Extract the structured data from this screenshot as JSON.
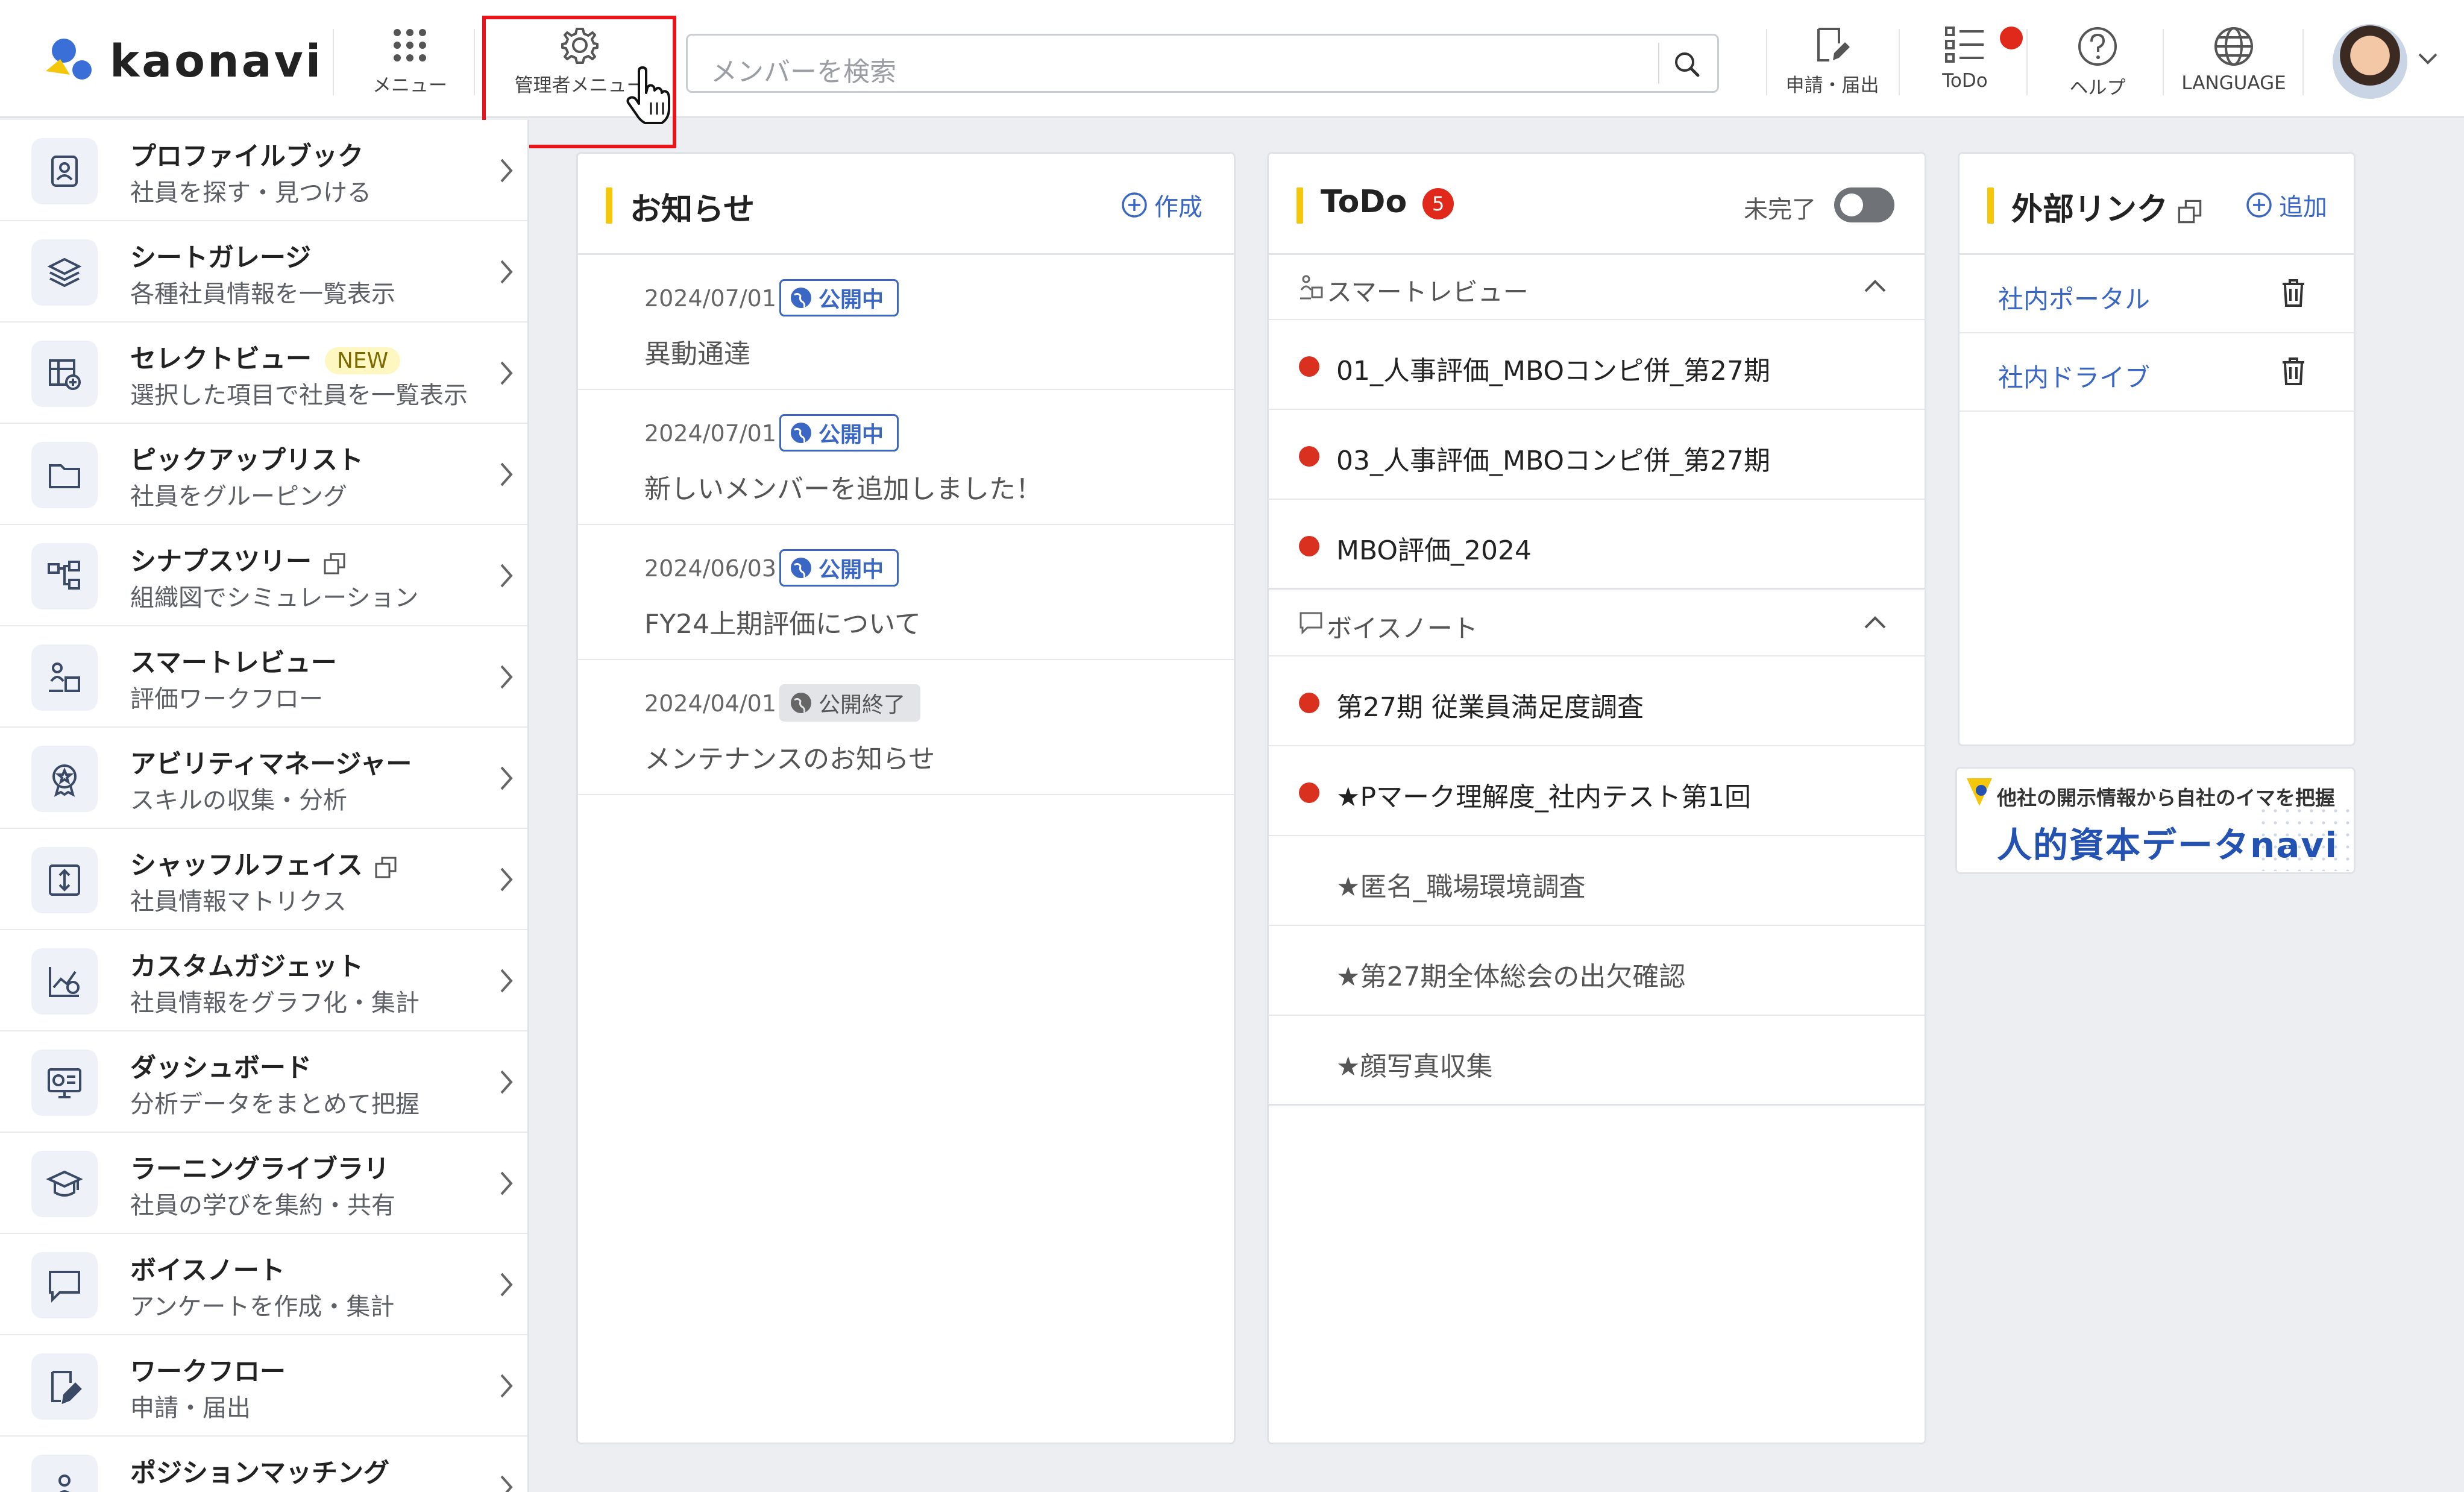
{
  "header": {
    "logo_text": "kaonavi",
    "menu_label": "メニュー",
    "admin_menu_label": "管理者メニュー",
    "search_placeholder": "メンバーを検索",
    "apply_label": "申請・届出",
    "todo_label": "ToDo",
    "help_label": "ヘルプ",
    "language_label": "LANGUAGE"
  },
  "sidebar": {
    "items": [
      {
        "title": "プロファイルブック",
        "subtitle": "社員を探す・見つける",
        "icon": "profile-book-icon"
      },
      {
        "title": "シートガレージ",
        "subtitle": "各種社員情報を一覧表示",
        "icon": "layers-icon"
      },
      {
        "title": "セレクトビュー",
        "badge": "NEW",
        "subtitle": "選択した項目で社員を一覧表示",
        "icon": "select-view-icon"
      },
      {
        "title": "ピックアップリスト",
        "subtitle": "社員をグルーピング",
        "icon": "folder-icon"
      },
      {
        "title": "シナプスツリー",
        "subtitle": "組織図でシミュレーション",
        "icon": "org-tree-icon"
      },
      {
        "title": "スマートレビュー",
        "subtitle": "評価ワークフロー",
        "icon": "review-icon"
      },
      {
        "title": "アビリティマネージャー",
        "subtitle": "スキルの収集・分析",
        "icon": "award-icon"
      },
      {
        "title": "シャッフルフェイス",
        "subtitle": "社員情報マトリクス",
        "icon": "shuffle-icon"
      },
      {
        "title": "カスタムガジェット",
        "subtitle": "社員情報をグラフ化・集計",
        "icon": "chart-icon"
      },
      {
        "title": "ダッシュボード",
        "subtitle": "分析データをまとめて把握",
        "icon": "dashboard-icon"
      },
      {
        "title": "ラーニングライブラリ",
        "subtitle": "社員の学びを集約・共有",
        "icon": "graduation-cap-icon"
      },
      {
        "title": "ボイスノート",
        "subtitle": "アンケートを作成・集計",
        "icon": "speech-bubble-icon"
      },
      {
        "title": "ワークフロー",
        "subtitle": "申請・届出",
        "icon": "workflow-icon"
      },
      {
        "title": "ポジションマッチング",
        "subtitle": "",
        "icon": "position-icon"
      }
    ]
  },
  "news": {
    "title": "お知らせ",
    "create_label": "作成",
    "items": [
      {
        "date": "2024/07/01",
        "status": "公開中",
        "body": "異動通達"
      },
      {
        "date": "2024/07/01",
        "status": "公開中",
        "body": "新しいメンバーを追加しました！"
      },
      {
        "date": "2024/06/03",
        "status": "公開中",
        "body": "FY24上期評価について"
      },
      {
        "date": "2024/04/01",
        "status": "公開終了",
        "body": "メンテナンスのお知らせ"
      }
    ]
  },
  "todo": {
    "title": "ToDo",
    "count": "5",
    "incomplete_label": "未完了",
    "sections": [
      {
        "label": "スマートレビュー",
        "items": [
          "01_人事評価_MBOコンピ併_第27期",
          "03_人事評価_MBOコンピ併_第27期",
          "MBO評価_2024"
        ]
      },
      {
        "label": "ボイスノート",
        "items": [
          "第27期 従業員満足度調査",
          "★Pマーク理解度_社内テスト第1回",
          "★匿名_職場環境調査",
          "★第27期全体総会の出欠確認",
          "★顔写真収集"
        ]
      }
    ]
  },
  "links": {
    "title": "外部リンク",
    "add_label": "追加",
    "items": [
      "社内ポータル",
      "社内ドライブ"
    ]
  },
  "banner": {
    "line1": "他社の開示情報から自社のイマを把握",
    "line2": "人的資本データnavi"
  },
  "colors": {
    "accent": "#3a66c4",
    "highlight": "#e8141b",
    "brand_yellow": "#f4c70a",
    "alert": "#e0281b"
  }
}
